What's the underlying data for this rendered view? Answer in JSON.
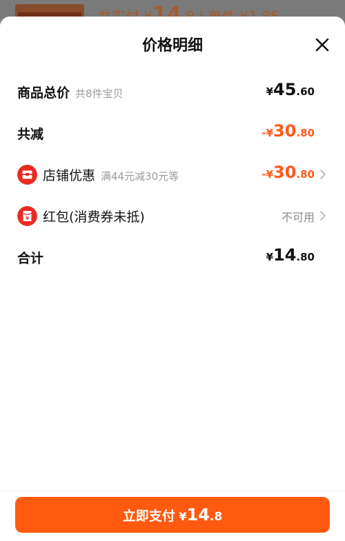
{
  "background": {
    "text_prefix": "共实付 ¥",
    "text_big": "14",
    "text_rest": ".8 | 单件 ¥1.85"
  },
  "sheet": {
    "title": "价格明细",
    "close_label": "×"
  },
  "rows": {
    "total": {
      "label": "商品总价",
      "sub": "共8件宝贝",
      "currency": "¥",
      "int": "45",
      "dec": ".60"
    },
    "reduced": {
      "label": "共减",
      "sign_currency": "-¥",
      "int": "30",
      "dec": ".80"
    },
    "shop_discount": {
      "label": "店铺优惠",
      "sub": "满44元减30元等",
      "sign_currency": "-¥",
      "int": "30",
      "dec": ".80"
    },
    "red_packet": {
      "label": "红包(消费券未抵)",
      "status": "不可用",
      "icon_glyph": "¥"
    },
    "sum": {
      "label": "合计",
      "currency": "¥",
      "int": "14",
      "dec": ".80"
    }
  },
  "footer": {
    "button_label": "立即支付",
    "currency": "¥",
    "int": "14",
    "dec": ".8"
  },
  "colors": {
    "accent": "#ff5a10",
    "discount": "#ff5a1a",
    "badge_red": "#ea2a23"
  }
}
